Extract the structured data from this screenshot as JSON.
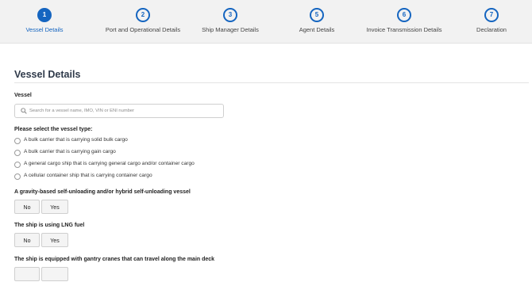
{
  "stepper": {
    "steps": [
      {
        "number": "1",
        "label": "Vessel Details"
      },
      {
        "number": "2",
        "label": "Port and Operational Details"
      },
      {
        "number": "3",
        "label": "Ship Manager Details"
      },
      {
        "number": "5",
        "label": "Agent Details"
      },
      {
        "number": "6",
        "label": "Invoice Transmission Details"
      },
      {
        "number": "7",
        "label": "Declaration"
      }
    ],
    "active_step": 1
  },
  "vessel_details": {
    "title": "Vessel Details",
    "vessel_label": "Vessel",
    "vessel_search": {
      "value": "",
      "placeholder": "Search for a vessel name, IMO, VIN or ENI number"
    },
    "vessel_type_prompt": "Please select the vessel type:",
    "vessel_types": [
      "A bulk carrier that is carrying solid bulk cargo",
      "A bulk carrier that is carrying gain cargo",
      "A general cargo ship that is carrying general cargo and/or container cargo",
      "A cellular container ship that is carrying container cargo"
    ],
    "questions": [
      {
        "label": "A gravity-based self-unloading and/or hybrid self-unloading vessel",
        "no": "No",
        "yes": "Yes"
      },
      {
        "label": "The ship is using LNG fuel",
        "no": "No",
        "yes": "Yes"
      },
      {
        "label": "The ship is equipped with gantry cranes that can travel along the main deck"
      }
    ]
  },
  "colors": {
    "accent": "#1565c0",
    "stepper_bg": "#f2f2f2",
    "title": "#2f3a4a"
  }
}
